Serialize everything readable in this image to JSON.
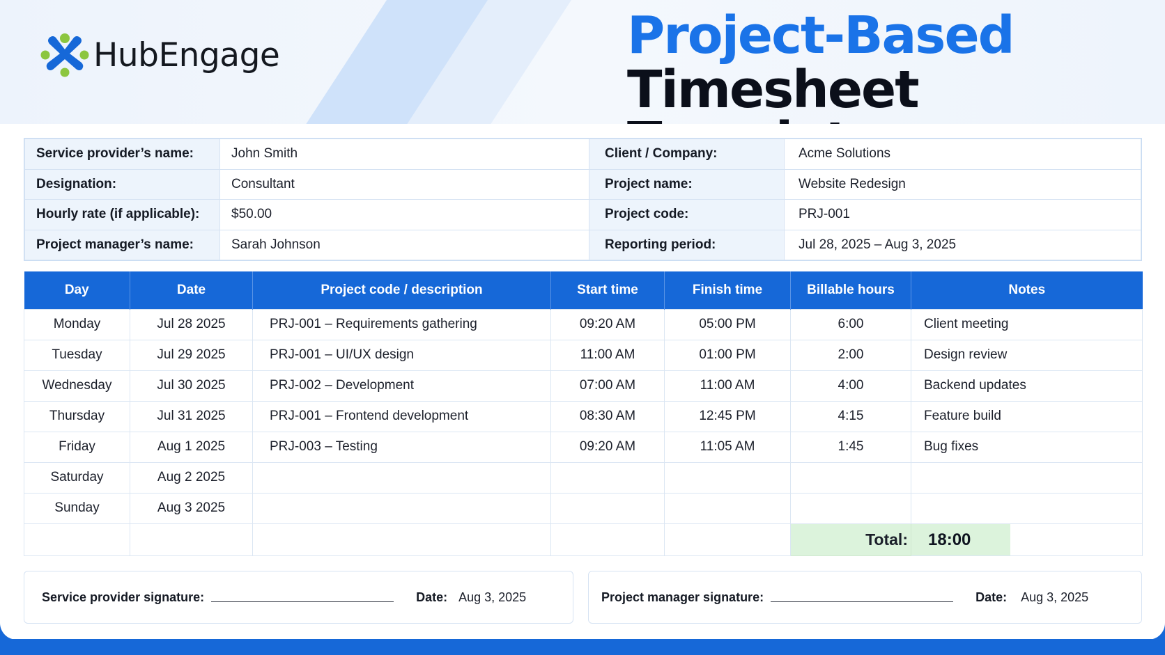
{
  "brand": {
    "name": "HubEngage",
    "colors": {
      "primary_blue": "#1668d8",
      "title_blue": "#1a73e8",
      "logo_green": "#8cc63f",
      "total_green": "#dcf3dc"
    }
  },
  "title": {
    "line1": "Project-Based",
    "line2": "Timesheet Template"
  },
  "info": {
    "rows": [
      {
        "l1": "Service provider’s name:",
        "v1": "John Smith",
        "l2": "Client / Company:",
        "v2": "Acme Solutions"
      },
      {
        "l1": "Designation:",
        "v1": "Consultant",
        "l2": "Project name:",
        "v2": "Website Redesign"
      },
      {
        "l1": "Hourly rate (if applicable):",
        "v1": "$50.00",
        "l2": "Project code:",
        "v2": "PRJ-001"
      },
      {
        "l1": "Project manager’s name:",
        "v1": "Sarah Johnson",
        "l2": "Reporting period:",
        "v2": "Jul 28, 2025 – Aug 3, 2025"
      }
    ]
  },
  "timesheet": {
    "headers": [
      "Day",
      "Date",
      "Project code / description",
      "Start time",
      "Finish time",
      "Billable hours",
      "Notes"
    ],
    "rows": [
      {
        "day": "Monday",
        "date": "Jul 28 2025",
        "desc": "PRJ-001 – Requirements gathering",
        "start": "09:20 AM",
        "finish": "05:00 PM",
        "hours": "6:00",
        "notes": "Client meeting"
      },
      {
        "day": "Tuesday",
        "date": "Jul 29 2025",
        "desc": "PRJ-001 – UI/UX design",
        "start": "11:00 AM",
        "finish": "01:00 PM",
        "hours": "2:00",
        "notes": "Design review"
      },
      {
        "day": "Wednesday",
        "date": "Jul 30 2025",
        "desc": "PRJ-002 – Development",
        "start": "07:00 AM",
        "finish": "11:00 AM",
        "hours": "4:00",
        "notes": "Backend updates"
      },
      {
        "day": "Thursday",
        "date": "Jul 31 2025",
        "desc": "PRJ-001 – Frontend development",
        "start": "08:30 AM",
        "finish": "12:45 PM",
        "hours": "4:15",
        "notes": "Feature build"
      },
      {
        "day": "Friday",
        "date": "Aug 1 2025",
        "desc": "PRJ-003 – Testing",
        "start": "09:20 AM",
        "finish": "11:05 AM",
        "hours": "1:45",
        "notes": "Bug fixes"
      },
      {
        "day": "Saturday",
        "date": "Aug 2 2025",
        "desc": "",
        "start": "",
        "finish": "",
        "hours": "",
        "notes": ""
      },
      {
        "day": "Sunday",
        "date": "Aug 3 2025",
        "desc": "",
        "start": "",
        "finish": "",
        "hours": "",
        "notes": ""
      }
    ],
    "total_label": "Total:",
    "total_value": "18:00"
  },
  "signatures": {
    "provider": {
      "label": "Service provider signature:",
      "date_label": "Date:",
      "date": "Aug 3, 2025"
    },
    "manager": {
      "label": "Project manager signature:",
      "date_label": "Date:",
      "date": "Aug 3, 2025"
    }
  }
}
